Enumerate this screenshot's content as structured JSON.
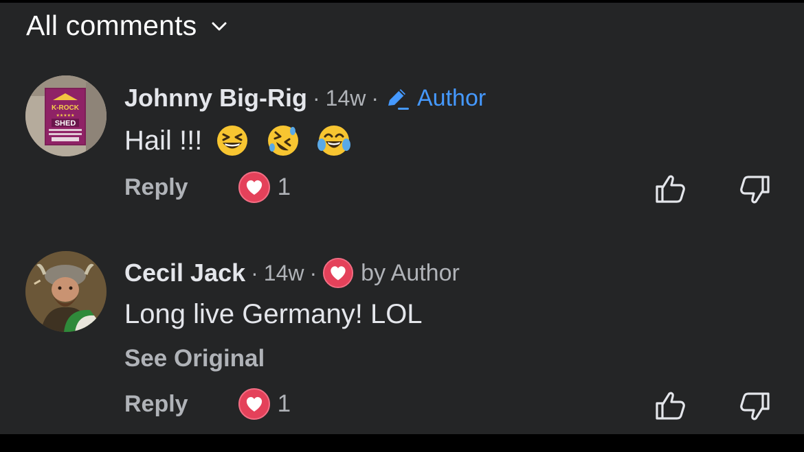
{
  "filter": {
    "label": "All comments",
    "icon": "chevron-down-icon"
  },
  "comments": [
    {
      "author": "Johnny Big-Rig",
      "time": "14w",
      "dot": "·",
      "badge": "Author",
      "badge_icon": "pencil-icon",
      "text": "Hail !!!",
      "emojis": [
        "grinning-squinting-face-emoji",
        "rolling-on-floor-laughing-emoji",
        "tears-of-joy-emoji"
      ],
      "avatar_text": {
        "brand": "K-ROCK",
        "name": "SHED"
      },
      "reply_label": "Reply",
      "reaction_count": "1",
      "reaction_icon": "heart-reaction-icon"
    },
    {
      "author": "Cecil Jack",
      "time": "14w",
      "dot": "·",
      "liked_label": "by Author",
      "liked_icon": "heart-reaction-icon",
      "text": "Long live Germany! LOL",
      "see_original": "See Original",
      "reply_label": "Reply",
      "reaction_count": "1",
      "reaction_icon": "heart-reaction-icon"
    }
  ],
  "colors": {
    "background": "#242526",
    "text": "#e4e6eb",
    "muted": "#b0b3b8",
    "author_blue": "#4599ff",
    "heart_red": "#e4415a"
  }
}
